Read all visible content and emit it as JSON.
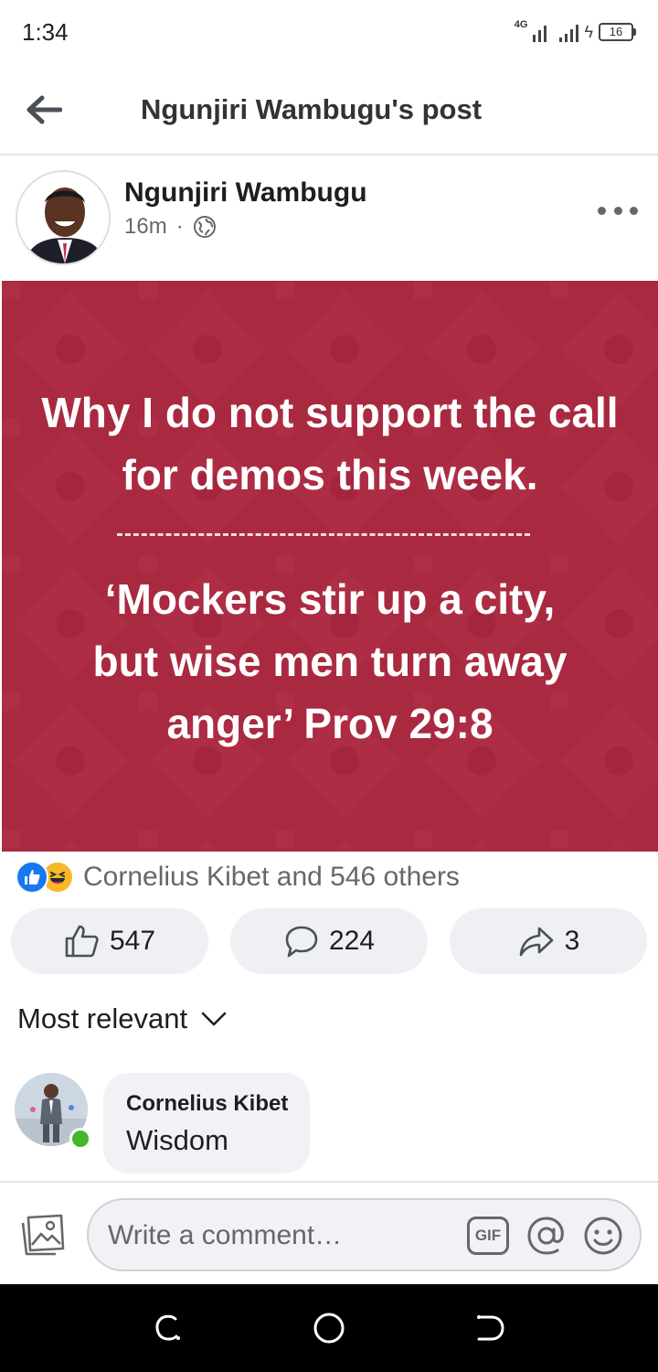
{
  "status_bar": {
    "time": "1:34",
    "network": "4G",
    "battery": "16"
  },
  "header": {
    "title": "Ngunjiri Wambugu's post"
  },
  "post": {
    "author": "Ngunjiri Wambugu",
    "time": "16m",
    "separator": "·",
    "privacy_icon": "globe-icon",
    "image": {
      "background_color": "#ac2a42",
      "title_line1": "Why I do not support the call",
      "title_line2": "for demos this week.",
      "quote_line1": "‘Mockers stir up a city,",
      "quote_line2": "but wise men turn away",
      "quote_line3": "anger’ Prov 29:8"
    },
    "reactions": {
      "summary": "Cornelius Kibet and 546 others",
      "types": [
        "like",
        "haha"
      ]
    },
    "actions": {
      "likes": "547",
      "comments": "224",
      "shares": "3"
    }
  },
  "comments": {
    "sort_label": "Most relevant",
    "items": [
      {
        "author": "Cornelius Kibet",
        "text": "Wisdom",
        "online": true
      }
    ]
  },
  "composer": {
    "placeholder": "Write a comment…",
    "gif_label": "GIF"
  },
  "colors": {
    "accent": "#1877f2",
    "online": "#42b72a",
    "post_bg": "#ac2a42"
  }
}
